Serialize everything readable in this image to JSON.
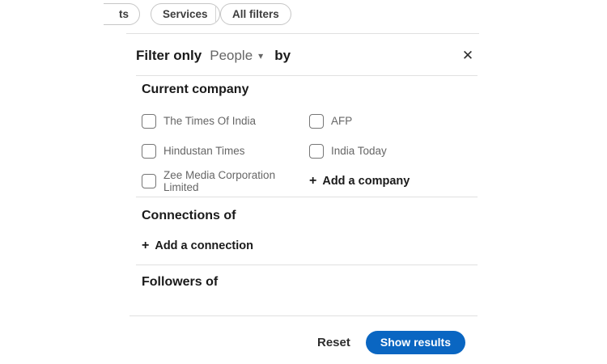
{
  "filter_bar": {
    "pill_partial_label": "ts",
    "pill_services_label": "Services",
    "pill_all_filters_label": "All filters"
  },
  "modal": {
    "header": {
      "filter_only_label": "Filter only",
      "entity_value": "People",
      "by_label": "by",
      "caret_icon": "▾",
      "close_icon": "✕"
    },
    "current_company": {
      "title": "Current company",
      "options": [
        {
          "label": "The Times Of India",
          "checked": false
        },
        {
          "label": "AFP",
          "checked": false
        },
        {
          "label": "Hindustan Times",
          "checked": false
        },
        {
          "label": "India Today",
          "checked": false
        },
        {
          "label": "Zee Media Corporation Limited",
          "checked": false
        }
      ],
      "add_button": {
        "plus_icon": "+",
        "label": "Add a company"
      }
    },
    "connections_of": {
      "title": "Connections of",
      "add_button": {
        "plus_icon": "+",
        "label": "Add a connection"
      }
    },
    "followers_of": {
      "title": "Followers of"
    },
    "footer": {
      "reset_label": "Reset",
      "show_results_label": "Show results"
    }
  },
  "colors": {
    "primary_blue": "#0a66c2",
    "text_dark": "#1a1a1a",
    "text_gray": "#666666",
    "divider": "#e0e0e0",
    "pill_border": "#c6c6c6"
  }
}
